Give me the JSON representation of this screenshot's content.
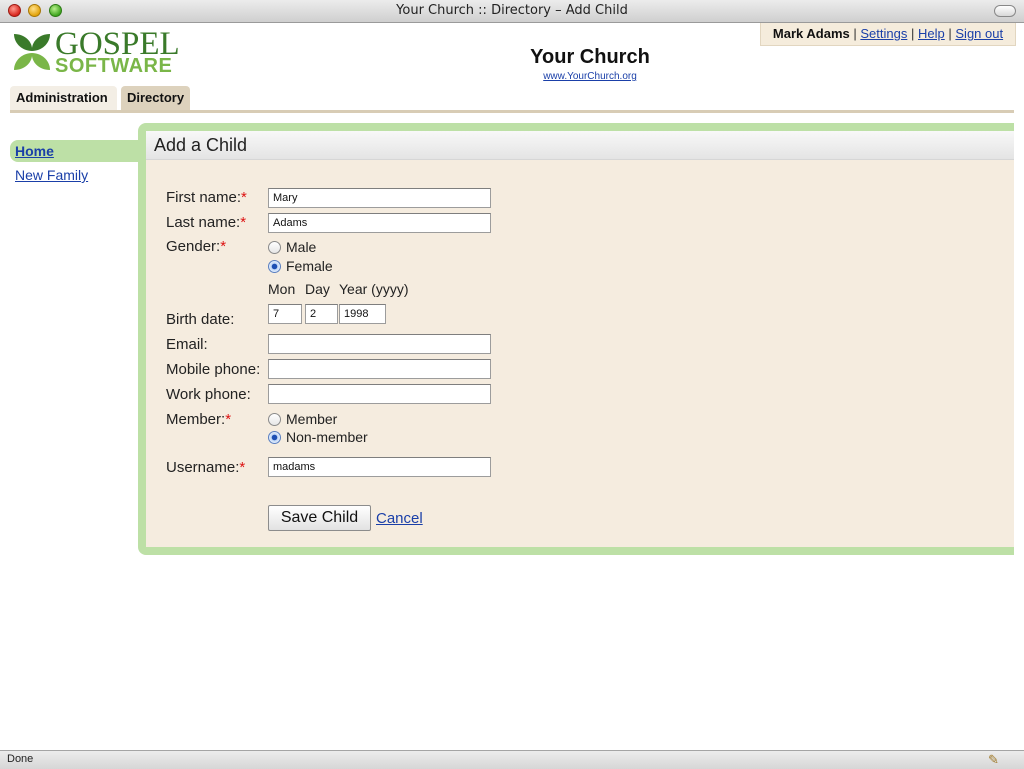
{
  "window": {
    "title": "Your Church :: Directory – Add Child"
  },
  "logo": {
    "line1": "GOSPEL",
    "line2": "SOFTWARE"
  },
  "user_menu": {
    "user": "Mark Adams",
    "settings": "Settings",
    "help": "Help",
    "signout": "Sign out",
    "separator": "|"
  },
  "header": {
    "church_name": "Your Church",
    "church_url": "www.YourChurch.org"
  },
  "tabs": [
    {
      "label": "Administration",
      "active": false
    },
    {
      "label": "Directory",
      "active": true
    }
  ],
  "sidebar": {
    "items": [
      {
        "label": "Home",
        "active": true
      },
      {
        "label": "New Family",
        "active": false
      }
    ]
  },
  "form": {
    "heading": "Add a Child",
    "required_mark": "*",
    "first_name": {
      "label": "First name:",
      "value": "Mary"
    },
    "last_name": {
      "label": "Last name:",
      "value": "Adams"
    },
    "gender": {
      "label": "Gender:",
      "options": [
        "Male",
        "Female"
      ],
      "selected": "Female"
    },
    "date_headers": {
      "mon": "Mon",
      "day": "Day",
      "year": "Year (yyyy)"
    },
    "birth_date": {
      "label": "Birth date:",
      "mon": "7",
      "day": "2",
      "year": "1998"
    },
    "email": {
      "label": "Email:",
      "value": ""
    },
    "mobile_phone": {
      "label": "Mobile phone:",
      "value": ""
    },
    "work_phone": {
      "label": "Work phone:",
      "value": ""
    },
    "member": {
      "label": "Member:",
      "options": [
        "Member",
        "Non-member"
      ],
      "selected": "Non-member"
    },
    "username": {
      "label": "Username:",
      "value": "madams"
    },
    "save_label": "Save Child",
    "cancel_label": "Cancel"
  },
  "status": {
    "text": "Done"
  },
  "colors": {
    "accent_green": "#bde0a6",
    "panel_bg": "#f5ecdf",
    "link": "#1a3fa8",
    "required": "#dd1111"
  },
  "icons": [
    "close-icon",
    "minimize-icon",
    "zoom-icon",
    "toolbar-toggle-icon",
    "gospel-leaf-icon",
    "edit-pencil-icon"
  ]
}
